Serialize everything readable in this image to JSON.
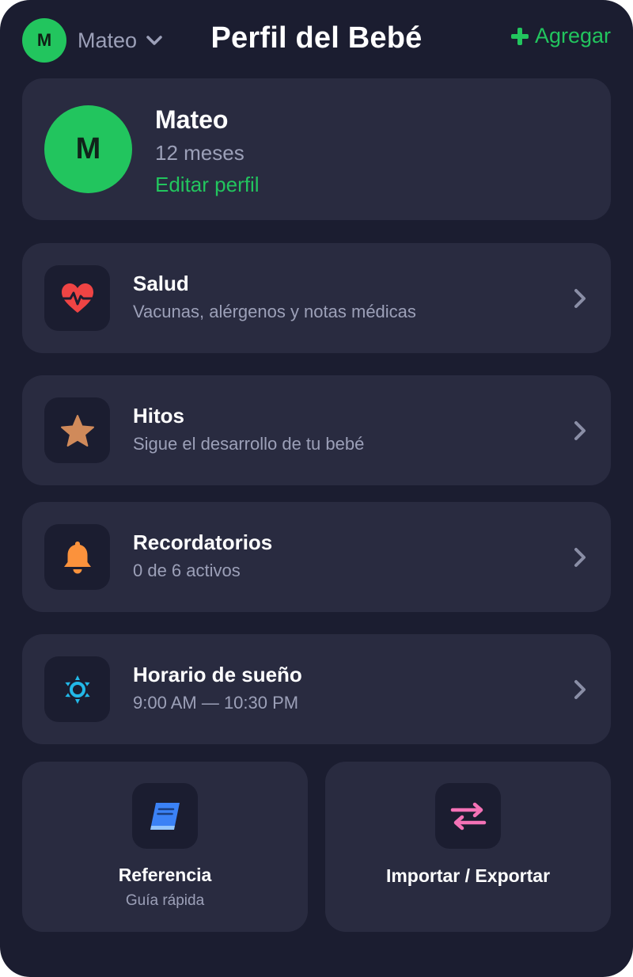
{
  "header": {
    "baby_initial": "M",
    "baby_name": "Mateo",
    "title": "Perfil del Bebé",
    "add_label": "Agregar"
  },
  "profile": {
    "initial": "M",
    "name": "Mateo",
    "age": "12 meses",
    "edit_label": "Editar perfil"
  },
  "menu": [
    {
      "title": "Salud",
      "subtitle": "Vacunas, alérgenos y notas médicas",
      "icon": "heart-pulse-icon"
    },
    {
      "title": "Hitos",
      "subtitle": "Sigue el desarrollo de tu bebé",
      "icon": "star-icon"
    },
    {
      "title": "Recordatorios",
      "subtitle": "0 de 6 activos",
      "icon": "bell-icon"
    },
    {
      "title": "Horario de sueño",
      "subtitle": "9:00 AM — 10:30 PM",
      "icon": "sun-icon"
    }
  ],
  "tiles": [
    {
      "title": "Referencia",
      "subtitle": "Guía rápida",
      "icon": "book-icon"
    },
    {
      "title": "Importar / Exportar",
      "icon": "swap-arrows-icon"
    }
  ],
  "colors": {
    "background": "#1b1d30",
    "card": "#292b40",
    "accent_green": "#22c55e",
    "heart": "#ef4444",
    "star": "#d08a5a",
    "bell": "#fb923c",
    "sun": "#22b8e8",
    "book": "#3b82f6",
    "swap": "#f472b6",
    "muted_text": "#9ca0b8"
  }
}
